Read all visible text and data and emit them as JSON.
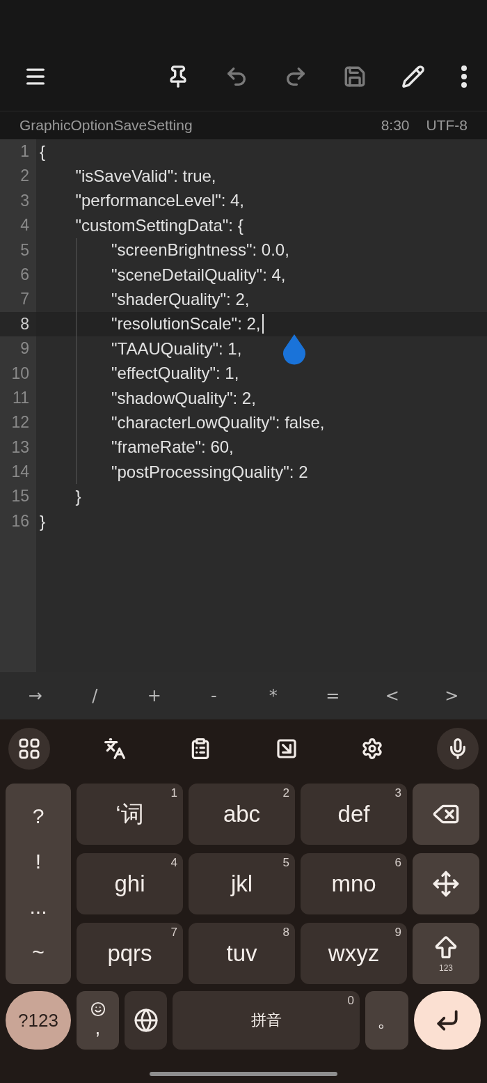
{
  "toolbar": [
    {
      "kind": "menu",
      "disabled": false
    },
    {
      "kind": "pin",
      "disabled": false
    },
    {
      "kind": "undo",
      "disabled": true
    },
    {
      "kind": "redo",
      "disabled": true
    },
    {
      "kind": "save",
      "disabled": true
    },
    {
      "kind": "edit",
      "disabled": false
    },
    {
      "kind": "more",
      "disabled": false
    }
  ],
  "status_bar": {
    "file_name": "GraphicOptionSaveSetting",
    "position": "8:30",
    "encoding": "UTF-8"
  },
  "editor": {
    "lines": [
      {
        "number": "1",
        "text": "{",
        "current": false,
        "children": [
          {
            "number": "2",
            "text": "\"isSaveValid\": true,",
            "current": false
          },
          {
            "number": "3",
            "text": "\"performanceLevel\": 4,",
            "current": false
          },
          {
            "number": "4",
            "text": "\"customSettingData\": {",
            "current": false,
            "children": [
              {
                "number": "5",
                "text": "\"screenBrightness\": 0.0,",
                "current": false
              },
              {
                "number": "6",
                "text": "\"sceneDetailQuality\": 4,",
                "current": false
              },
              {
                "number": "7",
                "text": "\"shaderQuality\": 2,",
                "current": false
              },
              {
                "number": "8",
                "text": "\"resolutionScale\": 2,",
                "current": true
              },
              {
                "number": "9",
                "text": "\"TAAUQuality\": 1,",
                "current": false
              },
              {
                "number": "10",
                "text": "\"effectQuality\": 1,",
                "current": false
              },
              {
                "number": "11",
                "text": "\"shadowQuality\": 2,",
                "current": false
              },
              {
                "number": "12",
                "text": "\"characterLowQuality\": false,",
                "current": false
              },
              {
                "number": "13",
                "text": "\"frameRate\": 60,",
                "current": false
              },
              {
                "number": "14",
                "text": "\"postProcessingQuality\": 2",
                "current": false
              }
            ]
          },
          {
            "number": "15",
            "text": "}",
            "current": false
          }
        ]
      },
      {
        "number": "16",
        "text": "}",
        "current": false
      }
    ]
  },
  "symbol_bar": [
    "→",
    "/",
    "+",
    "-",
    "*",
    "=",
    "<",
    ">"
  ],
  "keyboard": {
    "tools": [
      {
        "kind": "apps"
      },
      {
        "kind": "translate"
      },
      {
        "kind": "clipboard"
      },
      {
        "kind": "screenshot"
      },
      {
        "kind": "settings"
      },
      {
        "kind": "voice"
      }
    ],
    "punctuation": [
      "?",
      "!",
      "...",
      "~"
    ],
    "rows": [
      [
        {
          "label": "‘词",
          "digit": "1"
        },
        {
          "label": "abc",
          "digit": "2"
        },
        {
          "label": "def",
          "digit": "3"
        },
        {
          "kind": "backspace"
        }
      ],
      [
        {
          "label": "ghi",
          "digit": "4"
        },
        {
          "label": "jkl",
          "digit": "5"
        },
        {
          "label": "mno",
          "digit": "6"
        },
        {
          "kind": "cursor"
        }
      ],
      [
        {
          "label": "pqrs",
          "digit": "7"
        },
        {
          "label": "tuv",
          "digit": "8"
        },
        {
          "label": "wxyz",
          "digit": "9"
        },
        {
          "kind": "shift",
          "label": "123"
        }
      ]
    ],
    "bottom": [
      {
        "kind": "symbols",
        "label": "?123"
      },
      {
        "kind": "emoji",
        "label": ","
      },
      {
        "kind": "language"
      },
      {
        "kind": "space",
        "label": "拼音",
        "digit": "0"
      },
      {
        "kind": "period",
        "label": "。"
      },
      {
        "kind": "enter"
      }
    ]
  }
}
